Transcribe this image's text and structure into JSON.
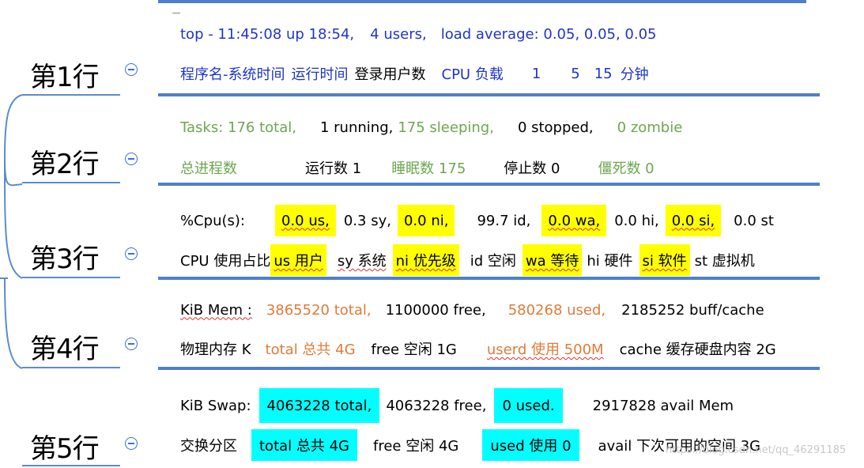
{
  "rows": [
    {
      "label": "第1行",
      "line1": {
        "a": "top - 11:45:08 up 18:54,",
        "b": "4 users,",
        "c": "load average: 0.05, 0.05, 0.05"
      },
      "line2": {
        "a": "程序名-系统时间",
        "b": "运行时间",
        "c": "登录用户数",
        "d": "CPU 负载",
        "e": "1",
        "f": "5",
        "g": "15",
        "h": "分钟"
      }
    },
    {
      "label": "第2行",
      "line1": {
        "a": "Tasks: 176 total,",
        "b": "1 running,",
        "c": "175 sleeping,",
        "d": "0 stopped,",
        "e": "0 zombie"
      },
      "line2": {
        "a": "总进程数",
        "b": "运行数 1",
        "c": "睡眠数 175",
        "d": "停止数 0",
        "e": "僵死数 0"
      }
    },
    {
      "label": "第3行",
      "line1": {
        "a": "%Cpu(s):",
        "b": "0.0 us,",
        "c": "0.3 sy,",
        "d": "0.0 ni,",
        "e": "99.7 id,",
        "f": "0.0 wa,",
        "g": "0.0 hi,",
        "h": "0.0 si,",
        "i": "0.0 st"
      },
      "line2": {
        "a": "CPU 使用占比",
        "b": "us 用户",
        "c": "sy 系统",
        "d": "ni 优先级",
        "e": "id 空闲",
        "f": "wa 等待",
        "g": "hi 硬件",
        "h": "si 软件",
        "i": "st 虚拟机"
      }
    },
    {
      "label": "第4行",
      "line1": {
        "a": "KiB Mem :",
        "b": "3865520 total,",
        "c": "1100000 free,",
        "d": "580268 used,",
        "e": "2185252 buff/cache"
      },
      "line2": {
        "a": "物理内存 K",
        "b": "total 总共 4G",
        "c": "free 空闲 1G",
        "d": "userd 使用 500M",
        "e": "cache 缓存硬盘内容 2G"
      }
    },
    {
      "label": "第5行",
      "line1": {
        "a": "KiB Swap:",
        "b": "4063228 total,",
        "c": "4063228 free,",
        "d": "0 used.",
        "e": "2917828 avail Mem"
      },
      "line2": {
        "a": "交换分区",
        "b": "total 总共 4G",
        "c": "free 空闲 4G",
        "d": "used 使用 0",
        "e": "avail 下次可用的空间 3G"
      }
    }
  ],
  "watermark": "https://blog.csdn.net/qq_46291185",
  "colors": {
    "blue": "#1f35c9",
    "green": "#6aa84f",
    "orange": "#e07b39",
    "yellow": "#ffff00",
    "cyan": "#00ffff",
    "separator": "#4f7fc9"
  }
}
